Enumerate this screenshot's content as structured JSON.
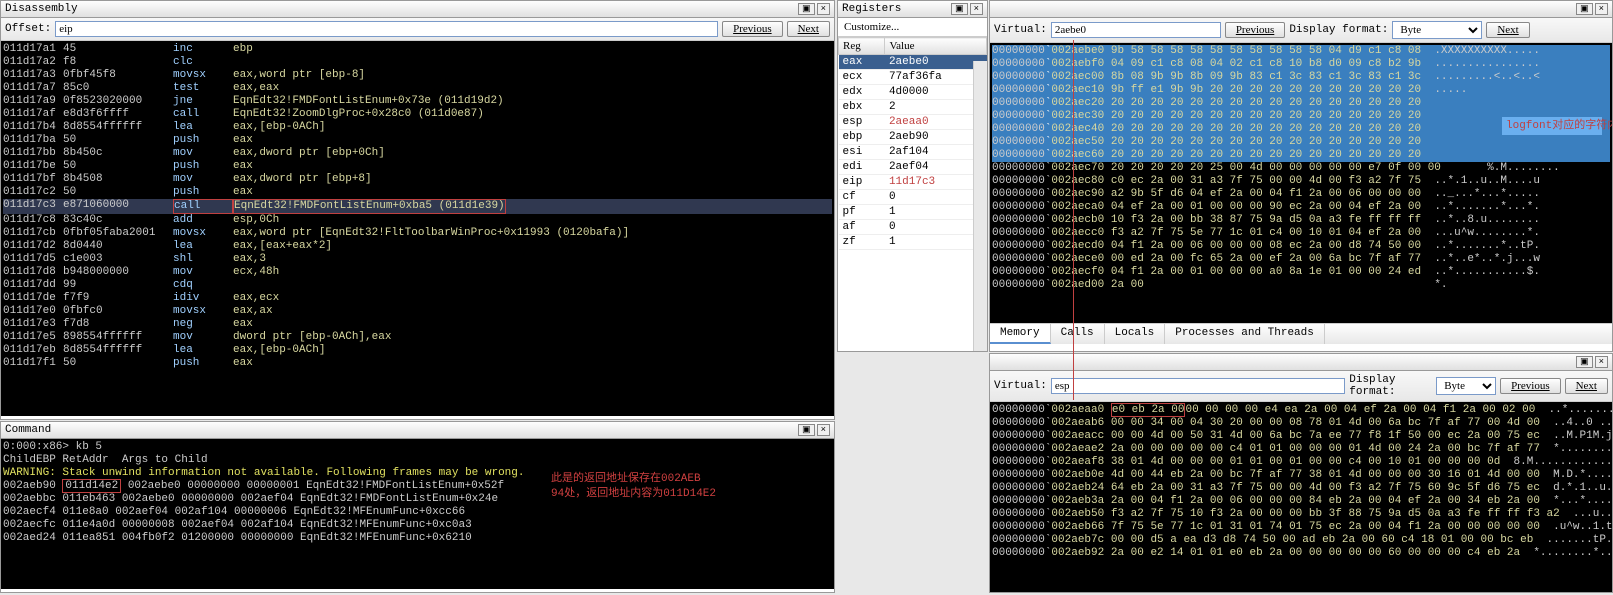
{
  "disasm": {
    "title": "Disassembly",
    "offset_label": "Offset:",
    "offset_value": "eip",
    "prev": "Previous",
    "next": "Next",
    "lines": [
      {
        "a": "011d17a1",
        "b": "45",
        "m": "inc",
        "o": "ebp"
      },
      {
        "a": "011d17a2",
        "b": "f8",
        "m": "clc",
        "o": ""
      },
      {
        "a": "011d17a3",
        "b": "0fbf45f8",
        "m": "movsx",
        "o": "eax,word ptr [ebp-8]"
      },
      {
        "a": "011d17a7",
        "b": "85c0",
        "m": "test",
        "o": "eax,eax"
      },
      {
        "a": "011d17a9",
        "b": "0f8523020000",
        "m": "jne",
        "o": "EqnEdt32!FMDFontListEnum+0x73e (011d19d2)"
      },
      {
        "a": "011d17af",
        "b": "e8d3f6ffff",
        "m": "call",
        "o": "EqnEdt32!ZoomDlgProc+0x28c0 (011d0e87)"
      },
      {
        "a": "011d17b4",
        "b": "8d8554ffffff",
        "m": "lea",
        "o": "eax,[ebp-0ACh]"
      },
      {
        "a": "011d17ba",
        "b": "50",
        "m": "push",
        "o": "eax"
      },
      {
        "a": "011d17bb",
        "b": "8b450c",
        "m": "mov",
        "o": "eax,dword ptr [ebp+0Ch]"
      },
      {
        "a": "011d17be",
        "b": "50",
        "m": "push",
        "o": "eax"
      },
      {
        "a": "011d17bf",
        "b": "8b4508",
        "m": "mov",
        "o": "eax,dword ptr [ebp+8]"
      },
      {
        "a": "011d17c2",
        "b": "50",
        "m": "push",
        "o": "eax"
      },
      {
        "a": "011d17c3",
        "b": "e871060000",
        "m": "call",
        "o": "EqnEdt32!FMDFontListEnum+0xba5 (011d1e39)",
        "hl": true
      },
      {
        "a": "011d17c8",
        "b": "83c40c",
        "m": "add",
        "o": "esp,0Ch"
      },
      {
        "a": "011d17cb",
        "b": "0fbf05faba2001",
        "m": "movsx",
        "o": "eax,word ptr [EqnEdt32!FltToolbarWinProc+0x11993 (0120bafa)]"
      },
      {
        "a": "011d17d2",
        "b": "8d0440",
        "m": "lea",
        "o": "eax,[eax+eax*2]"
      },
      {
        "a": "011d17d5",
        "b": "c1e003",
        "m": "shl",
        "o": "eax,3"
      },
      {
        "a": "011d17d8",
        "b": "b948000000",
        "m": "mov",
        "o": "ecx,48h"
      },
      {
        "a": "011d17dd",
        "b": "99",
        "m": "cdq",
        "o": ""
      },
      {
        "a": "011d17de",
        "b": "f7f9",
        "m": "idiv",
        "o": "eax,ecx"
      },
      {
        "a": "011d17e0",
        "b": "0fbfc0",
        "m": "movsx",
        "o": "eax,ax"
      },
      {
        "a": "011d17e3",
        "b": "f7d8",
        "m": "neg",
        "o": "eax"
      },
      {
        "a": "011d17e5",
        "b": "898554ffffff",
        "m": "mov",
        "o": "dword ptr [ebp-0ACh],eax"
      },
      {
        "a": "011d17eb",
        "b": "8d8554ffffff",
        "m": "lea",
        "o": "eax,[ebp-0ACh]"
      },
      {
        "a": "011d17f1",
        "b": "50",
        "m": "push",
        "o": "eax"
      }
    ]
  },
  "command": {
    "title": "Command",
    "lines": [
      "0:000:x86> kb 5",
      "ChildEBP RetAddr  Args to Child              ",
      "WARNING: Stack unwind information not available. Following frames may be wrong.",
      "002aeb90 |011d14e2| 002aebe0 00000000 00000001 EqnEdt32!FMDFontListEnum+0x52f",
      "002aebbc 011eb463 002aebe0 00000000 002aef04 EqnEdt32!FMDFontListEnum+0x24e",
      "002aecf4 011e8a0 002aef04 002af104 00000006 EqnEdt32!MFEnumFunc+0xcc66",
      "002aecfc 011e4a0d 00000008 002aef04 002af104 EqnEdt32!MFEnumFunc+0xc0a3",
      "002aed24 011ea851 004fb0f2 01200000 00000000 EqnEdt32!MFEnumFunc+0x6210"
    ],
    "annotation": "此是的返回地址保存在002AEB94处，返回地址内容为011D14E2"
  },
  "registers": {
    "title": "Registers",
    "customize": "Customize...",
    "hdr_reg": "Reg",
    "hdr_val": "Value",
    "rows": [
      {
        "r": "eax",
        "v": "2aebe0",
        "sel": true
      },
      {
        "r": "ecx",
        "v": "77af36fa"
      },
      {
        "r": "edx",
        "v": "4d0000"
      },
      {
        "r": "ebx",
        "v": "2"
      },
      {
        "r": "esp",
        "v": "2aeaa0",
        "red": true
      },
      {
        "r": "ebp",
        "v": "2aeb90"
      },
      {
        "r": "esi",
        "v": "2af104"
      },
      {
        "r": "edi",
        "v": "2aef04"
      },
      {
        "r": "eip",
        "v": "11d17c3",
        "red": true
      },
      {
        "r": "cf",
        "v": "0"
      },
      {
        "r": "pf",
        "v": "1"
      },
      {
        "r": "af",
        "v": "0"
      },
      {
        "r": "zf",
        "v": "1"
      }
    ]
  },
  "mem1": {
    "virtual_label": "Virtual:",
    "virtual_value": "2aebe0",
    "prev": "Previous",
    "display_label": "Display format:",
    "display_value": "Byte",
    "next": "Next",
    "tabs": [
      "Memory",
      "Calls",
      "Locals",
      "Processes and Threads"
    ],
    "annotation": "logfont对应的字符内容，将该长度内容赋值给时会溢出",
    "lines": [
      {
        "off": "00000000",
        "a": "002aebe0",
        "h": "9b 58 58 58 58 58 58 58 58 58 58 04 d9 c1 c8 08",
        "s": ".XXXXXXXXXX.....",
        "hl": true
      },
      {
        "off": "00000000",
        "a": "002aebf0",
        "h": "04 09 c1 c8 08 04 02 c1 c8 10 b8 d0 09 c8 b2 9b",
        "s": "................",
        "hl": true
      },
      {
        "off": "00000000",
        "a": "002aec00",
        "h": "8b 08 9b 9b 8b 09 9b 83 c1 3c 83 c1 3c 83 c1 3c",
        "s": ".........<..<..<",
        "hl": true
      },
      {
        "off": "00000000",
        "a": "002aec10",
        "h": "9b ff e1 9b 9b 20 20 20 20 20 20 20 20 20 20 20",
        "s": ".....           ",
        "hl": true
      },
      {
        "off": "00000000",
        "a": "002aec20",
        "h": "20 20 20 20 20 20 20 20 20 20 20 20 20 20 20 20",
        "s": "                ",
        "hl": true
      },
      {
        "off": "00000000",
        "a": "002aec30",
        "h": "20 20 20 20 20 20 20 20 20 20 20 20 20 20 20 20",
        "s": "                ",
        "hl": true
      },
      {
        "off": "00000000",
        "a": "002aec40",
        "h": "20 20 20 20 20 20 20 20 20 20 20 20 20 20 20 20",
        "s": "                ",
        "hl": true
      },
      {
        "off": "00000000",
        "a": "002aec50",
        "h": "20 20 20 20 20 20 20 20 20 20 20 20 20 20 20 20",
        "s": "                ",
        "hl": true
      },
      {
        "off": "00000000",
        "a": "002aec60",
        "h": "20 20 20 20 20 20 20 20 20 20 20 20 20 20 20 20",
        "s": "                ",
        "hl": true
      },
      {
        "off": "00000000",
        "a": "002aec70",
        "h": "20 20 20 20 20 25|00 4d 00 00 00 00 00 e7 0f 00 00",
        "s": "     %.M........"
      },
      {
        "off": "00000000",
        "a": "002aec80",
        "h": "c0 ec 2a 00 31 a3 7f 75 00 00 4d 00 f3 a2 7f 75",
        "s": "..*.1..u..M....u"
      },
      {
        "off": "00000000",
        "a": "002aec90",
        "h": "a2 9b 5f d6 04 ef 2a 00 04 f1 2a 00 06 00 00 00",
        "s": ".._...*...*....."
      },
      {
        "off": "00000000",
        "a": "002aeca0",
        "h": "04 ef 2a 00 01 00 00 00 90 ec 2a 00 04 ef 2a 00",
        "s": "..*.......*...*."
      },
      {
        "off": "00000000",
        "a": "002aecb0",
        "h": "10 f3 2a 00 bb 38 87 75 9a d5 0a a3 fe ff ff ff",
        "s": "..*..8.u........"
      },
      {
        "off": "00000000",
        "a": "002aecc0",
        "h": "f3 a2 7f 75 5e 77 1c 01 c4 00 10 01 04 ef 2a 00",
        "s": "...u^w........*."
      },
      {
        "off": "00000000",
        "a": "002aecd0",
        "h": "04 f1 2a 00 06 00 00 00 08 ec 2a 00 d8 74 50 00",
        "s": "..*.......*..tP."
      },
      {
        "off": "00000000",
        "a": "002aece0",
        "h": "00 ed 2a 00 fc 65 2a 00 ef 2a 00 6a bc 7f af 77",
        "s": "..*..e*..*.j...w"
      },
      {
        "off": "00000000",
        "a": "002aecf0",
        "h": "04 f1 2a 00 01 00 00 00 a0 8a 1e 01 00 00 24 ed",
        "s": "..*...........$."
      },
      {
        "off": "00000000",
        "a": "002aed00",
        "h": "2a 00                                          ",
        "s": "*."
      }
    ]
  },
  "mem2": {
    "virtual_label": "Virtual:",
    "virtual_value": "esp",
    "display_label": "Display format:",
    "display_value": "Byte",
    "prev": "Previous",
    "next": "Next",
    "lines": [
      {
        "off": "00000000",
        "a": "002aeaa0",
        "h": "|e0 eb 2a 00|00 00 00 00 e4 ea 2a 00 04 ef 2a 00 04 f1 2a 00 02 00",
        "s": "..*.......*...*...*..."
      },
      {
        "off": "00000000",
        "a": "002aeab6",
        "h": "00 00 34 00 04 30 20 00 00 08 78 01 4d 00 6a bc 7f af 77 00 4d 00",
        "s": "..4..0 ...x.M.j...w.M."
      },
      {
        "off": "00000000",
        "a": "002aeacc",
        "h": "00 00 4d 00 50 31 4d 00 6a bc 7a ee 77 f8 1f 50 00 ec 2a 00 75 ec",
        "s": "..M.P1M.j.z.w..P..*.u."
      },
      {
        "off": "00000000",
        "a": "002aeae2",
        "h": "2a 00 00 00 00 00 c4 01 01 00 00 00 01 4d 00 24 2a 00 bc 7f af 77",
        "s": "*............M.$*....w"
      },
      {
        "off": "00000000",
        "a": "002aeaf8",
        "h": "38 01 4d 00 00 00 01 01 00 01 00 00 c4 00 10 01 00 00 00 0d",
        "s": "8.M................."
      },
      {
        "off": "00000000",
        "a": "002aeb0e",
        "h": "4d 00 44 eb 2a 00 bc 7f af 77 38 01 4d 00 00 00 30 16 01 4d 00 00",
        "s": "M.D.*....w8.M...0..M.."
      },
      {
        "off": "00000000",
        "a": "002aeb24",
        "h": "64 eb 2a 00 31 a3 7f 75 00 00 4d 00 f3 a2 7f 75 60 9c 5f d6 75 ec",
        "s": "d.*.1..u..M....u`._.u."
      },
      {
        "off": "00000000",
        "a": "002aeb3a",
        "h": "2a 00 04 f1 2a 00 06 00 00 00 84 eb 2a 00 04 ef 2a 00 34 eb 2a 00",
        "s": "*...*.......*...*..4.*"
      },
      {
        "off": "00000000",
        "a": "002aeb50",
        "h": "f3 a2 7f 75 10 f3 2a 00 00 00 bb 3f 88 75 9a d5 0a a3 fe ff ff f3 a2",
        "s": "...u..*....?.u........."
      },
      {
        "off": "00000000",
        "a": "002aeb66",
        "h": "7f 75 5e 77 1c 01 31 01 74 01 75 ec 2a 00 04 f1 2a 00 00 00 00 00",
        "s": ".u^w..1.t.u.*...*....."
      },
      {
        "off": "00000000",
        "a": "002aeb7c",
        "h": "00 00 d5 a ea d3 d8 74 50 00 ad eb 2a 00 60 c4 18 01 00 00 bc eb",
        "s": ".......tP...*.`......."
      },
      {
        "off": "00000000",
        "a": "002aeb92",
        "h": "2a 00 e2 14 01 01 e0 eb 2a 00 00 00 00 00 60 00 00 00 c4 eb 2a",
        "s": "*........*.....`.....*"
      }
    ]
  }
}
